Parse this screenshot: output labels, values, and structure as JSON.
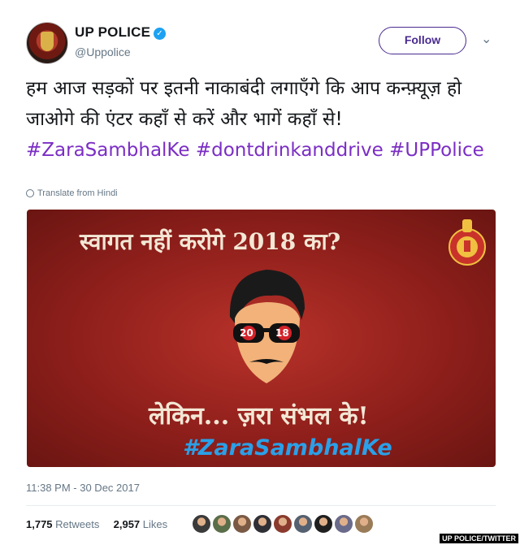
{
  "account": {
    "name": "UP POLICE",
    "handle": "@Uppolice",
    "verified_icon": "verified-badge-icon",
    "follow_label": "Follow"
  },
  "tweet": {
    "text_plain": "हम आज सड़कों पर इतनी नाकाबंदी लगाएँगे कि आप कन्फ़्यूज़ हो जाओगे की एंटर कहाँ से करें और भागें कहाँ से!",
    "hashtag_1": "#ZaraSambhalKe",
    "hashtag_2": "#dontdrinkanddrive",
    "hashtag_3": "#UPPolice",
    "translate_label": "Translate from Hindi"
  },
  "media": {
    "headline": "स्वागत नहीं करोगे 2018 का?",
    "glasses_left": "20",
    "glasses_right": "18",
    "bottom_text": "लेकिन... ज़रा संभल के!",
    "hashtag": "#ZaraSambhalKe",
    "background_color": "#9a221d"
  },
  "meta": {
    "timestamp": "11:38 PM - 30 Dec 2017",
    "retweets_count": "1,775",
    "retweets_label": "Retweets",
    "likes_count": "2,957",
    "likes_label": "Likes"
  },
  "likers": [
    {
      "color": "#3a3a3a"
    },
    {
      "color": "#5b6e4a"
    },
    {
      "color": "#7a5a44"
    },
    {
      "color": "#2f2f36"
    },
    {
      "color": "#8a3b2e"
    },
    {
      "color": "#556070"
    },
    {
      "color": "#1f1f1f"
    },
    {
      "color": "#6a6a8a"
    },
    {
      "color": "#9a7b58"
    }
  ],
  "credit": "UP POLICE/TWITTER",
  "colors": {
    "hashtag": "#7b2ec4",
    "follow": "#4a2a90",
    "verified": "#1da1f2"
  }
}
